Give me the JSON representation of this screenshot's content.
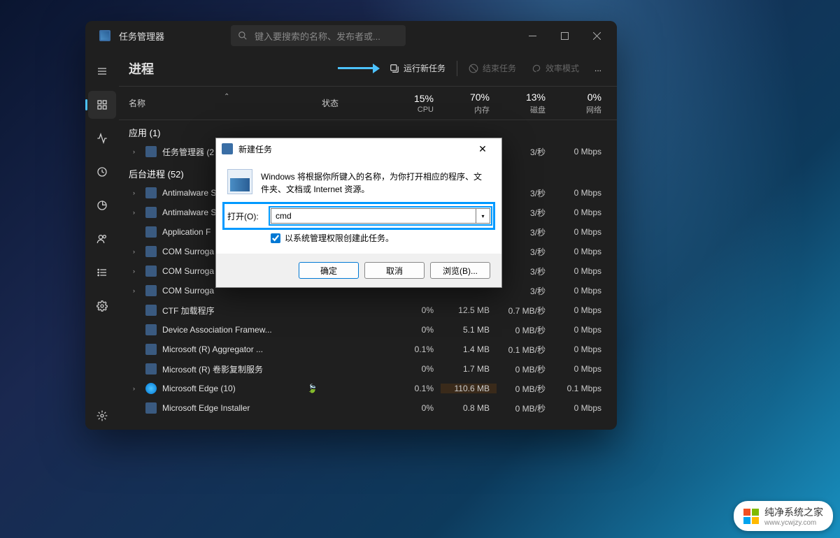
{
  "app_title": "任务管理器",
  "search_placeholder": "键入要搜索的名称、发布者或...",
  "page_title": "进程",
  "toolbar": {
    "run_new": "运行新任务",
    "end_task": "结束任务",
    "efficiency": "效率模式",
    "more": "..."
  },
  "columns": {
    "name": "名称",
    "status": "状态",
    "cpu_pct": "15%",
    "cpu_lbl": "CPU",
    "mem_pct": "70%",
    "mem_lbl": "内存",
    "disk_pct": "13%",
    "disk_lbl": "磁盘",
    "net_pct": "0%",
    "net_lbl": "网络"
  },
  "groups": {
    "apps": "应用 (1)",
    "bg": "后台进程 (52)"
  },
  "rows": [
    {
      "name": "任务管理器 (2",
      "exp": "›",
      "cpu": "",
      "mem": "",
      "disk": "3/秒",
      "net": "0 Mbps",
      "icon": "tm"
    },
    {
      "name": "Antimalware S",
      "exp": "›",
      "cpu": "",
      "mem": "",
      "disk": "3/秒",
      "net": "0 Mbps",
      "icon": "svc"
    },
    {
      "name": "Antimalware S",
      "exp": "›",
      "cpu": "",
      "mem": "",
      "disk": "3/秒",
      "net": "0 Mbps",
      "icon": "svc"
    },
    {
      "name": "Application F",
      "exp": "",
      "cpu": "",
      "mem": "",
      "disk": "3/秒",
      "net": "0 Mbps",
      "icon": "svc"
    },
    {
      "name": "COM Surroga",
      "exp": "›",
      "cpu": "",
      "mem": "",
      "disk": "3/秒",
      "net": "0 Mbps",
      "icon": "svc"
    },
    {
      "name": "COM Surroga",
      "exp": "›",
      "cpu": "",
      "mem": "",
      "disk": "3/秒",
      "net": "0 Mbps",
      "icon": "svc"
    },
    {
      "name": "COM Surroga",
      "exp": "›",
      "cpu": "",
      "mem": "",
      "disk": "3/秒",
      "net": "0 Mbps",
      "icon": "svc"
    },
    {
      "name": "CTF 加载程序",
      "exp": "",
      "cpu": "0%",
      "mem": "12.5 MB",
      "disk": "0.7 MB/秒",
      "net": "0 Mbps",
      "icon": "svc"
    },
    {
      "name": "Device Association Framew...",
      "exp": "",
      "cpu": "0%",
      "mem": "5.1 MB",
      "disk": "0 MB/秒",
      "net": "0 Mbps",
      "icon": "svc"
    },
    {
      "name": "Microsoft (R) Aggregator ...",
      "exp": "",
      "cpu": "0.1%",
      "mem": "1.4 MB",
      "disk": "0.1 MB/秒",
      "net": "0 Mbps",
      "icon": "svc"
    },
    {
      "name": "Microsoft (R) 卷影复制服务",
      "exp": "",
      "cpu": "0%",
      "mem": "1.7 MB",
      "disk": "0 MB/秒",
      "net": "0 Mbps",
      "icon": "svc"
    },
    {
      "name": "Microsoft Edge (10)",
      "exp": "›",
      "cpu": "0.1%",
      "mem": "110.6 MB",
      "disk": "0 MB/秒",
      "net": "0.1 Mbps",
      "icon": "edge",
      "leaf": true,
      "hot": true
    },
    {
      "name": "Microsoft Edge Installer",
      "exp": "",
      "cpu": "0%",
      "mem": "0.8 MB",
      "disk": "0 MB/秒",
      "net": "0 Mbps",
      "icon": "inst"
    }
  ],
  "dialog": {
    "title": "新建任务",
    "message": "Windows 将根据你所键入的名称，为你打开相应的程序、文件夹、文档或 Internet 资源。",
    "open_label": "打开(O):",
    "input_value": "cmd",
    "admin_checkbox": "以系统管理权限创建此任务。",
    "ok": "确定",
    "cancel": "取消",
    "browse": "浏览(B)..."
  },
  "watermark": {
    "name": "纯净系统之家",
    "url": "www.ycwjzy.com"
  }
}
